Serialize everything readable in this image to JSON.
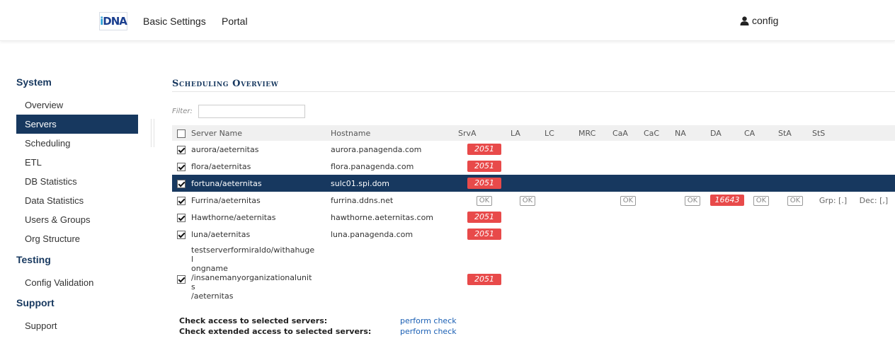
{
  "header": {
    "logo_text_i": "i",
    "logo_text_rest": "DNA",
    "nav": [
      "Basic Settings",
      "Portal"
    ],
    "user": "config"
  },
  "sidebar": {
    "sections": [
      {
        "title": "System",
        "items": [
          "Overview",
          "Servers",
          "Scheduling",
          "ETL",
          "DB Statistics",
          "Data Statistics",
          "Users & Groups",
          "Org Structure"
        ]
      },
      {
        "title": "Testing",
        "items": [
          "Config Validation"
        ]
      },
      {
        "title": "Support",
        "items": [
          "Support"
        ]
      }
    ],
    "active_item": "Servers"
  },
  "main": {
    "title": "Scheduling Overview",
    "filter_label": "Filter:",
    "filter_value": "",
    "columns": [
      "Server Name",
      "Hostname",
      "SrvA",
      "LA",
      "LC",
      "MRC",
      "CaA",
      "CaC",
      "NA",
      "DA",
      "CA",
      "StA",
      "StS"
    ],
    "rows": [
      {
        "server": "aurora/aeternitas",
        "host": "aurora.panagenda.com",
        "srva": "2051"
      },
      {
        "server": "flora/aeternitas",
        "host": "flora.panagenda.com",
        "srva": "2051"
      },
      {
        "server": "fortuna/aeternitas",
        "host": "sulc01.spi.dom",
        "srva": "2051"
      },
      {
        "server": "Furrina/aeternitas",
        "host": "furrina.ddns.net",
        "srva": "OK",
        "la": "OK",
        "caa": "OK",
        "na": "OK",
        "da": "16643",
        "ca": "OK",
        "sta": "OK",
        "sts_grp": "Grp: [.]",
        "sts_dec": "Dec: [,]"
      },
      {
        "server": "Hawthorne/aeternitas",
        "host": "hawthorne.aeternitas.com",
        "srva": "2051"
      },
      {
        "server": "luna/aeternitas",
        "host": "luna.panagenda.com",
        "srva": "2051"
      },
      {
        "server": "testserverformiraldo/withahugelongname/insanemanyorganizationalunits/aeternitas",
        "server_lines": [
          "testserverformiraldo/withahugel",
          "ongname",
          "/insanemanyorganizationalunits",
          "/aeternitas"
        ],
        "host": "",
        "srva": "2051"
      }
    ],
    "selected_row": 2,
    "checks": [
      {
        "label": "Check access to selected servers:",
        "link": "perform check"
      },
      {
        "label": "Check extended access to selected servers:",
        "link": "perform check"
      }
    ]
  },
  "colors": {
    "navy": "#17385f",
    "red": "#e84a4a",
    "link": "#1a5fb4"
  }
}
